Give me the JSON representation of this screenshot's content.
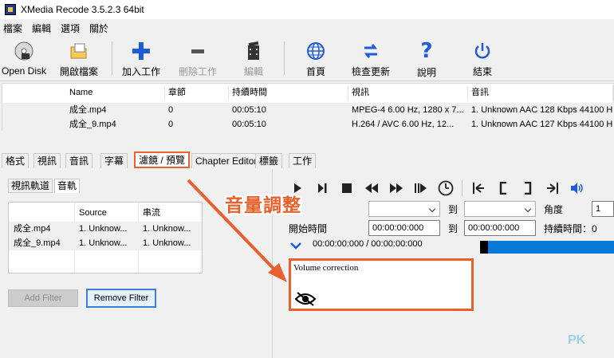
{
  "window": {
    "title": "XMedia Recode 3.5.2.3 64bit"
  },
  "menu": [
    "檔案",
    "編輯",
    "選項",
    "關於"
  ],
  "toolbar": {
    "open_disk": "Open Disk",
    "open_file": "開啟檔案",
    "add_job": "加入工作",
    "remove_job": "刪除工作",
    "edit": "編輯",
    "home": "首頁",
    "check_update": "檢查更新",
    "help": "說明",
    "exit": "結束"
  },
  "file_list": {
    "headers": [
      "Name",
      "章節",
      "持續時間",
      "視訊",
      "音訊"
    ],
    "rows": [
      [
        "成全.mp4",
        "0",
        "00:05:10",
        "MPEG-4 6.00 Hz, 1280 x 7...",
        "1. Unknown AAC  128 Kbps 44100 H"
      ],
      [
        "成全_9.mp4",
        "0",
        "00:05:10",
        "H.264 / AVC  6.00 Hz, 12...",
        "1. Unknown AAC  127 Kbps 44100 H"
      ]
    ]
  },
  "tabs": [
    "格式",
    "視訊",
    "音訊",
    "字幕",
    "濾鏡 / 預覽",
    "Chapter Editor",
    "標籤",
    "工作"
  ],
  "sub_tabs": [
    "視訊軌道",
    "音軌"
  ],
  "filter_table": {
    "headers": [
      "Source",
      "串流"
    ],
    "rows": [
      [
        "成全.mp4",
        "1. Unknow...",
        "1. Unknow..."
      ],
      [
        "成全_9.mp4",
        "1. Unknow...",
        "1. Unknow..."
      ]
    ]
  },
  "buttons": {
    "add_filter": "Add Filter",
    "remove_filter": "Remove Filter"
  },
  "preview": {
    "to_label_1": "到",
    "to_label_2": "到",
    "angle_label": "角度",
    "angle_value": "1",
    "start_time_label": "開始時間",
    "start_time_value": "00:00:00:000",
    "end_time_value": "00:00:00:000",
    "duration_label": "持續時間：0",
    "position_text": "00:00:00:000 / 00:00:00:000",
    "volume_correction": "Volume correction"
  },
  "annotation": {
    "callout": "音量調整"
  },
  "watermark": "PK",
  "colors": {
    "accent_orange": "#e8612c",
    "progress_blue": "#0a78d7"
  }
}
